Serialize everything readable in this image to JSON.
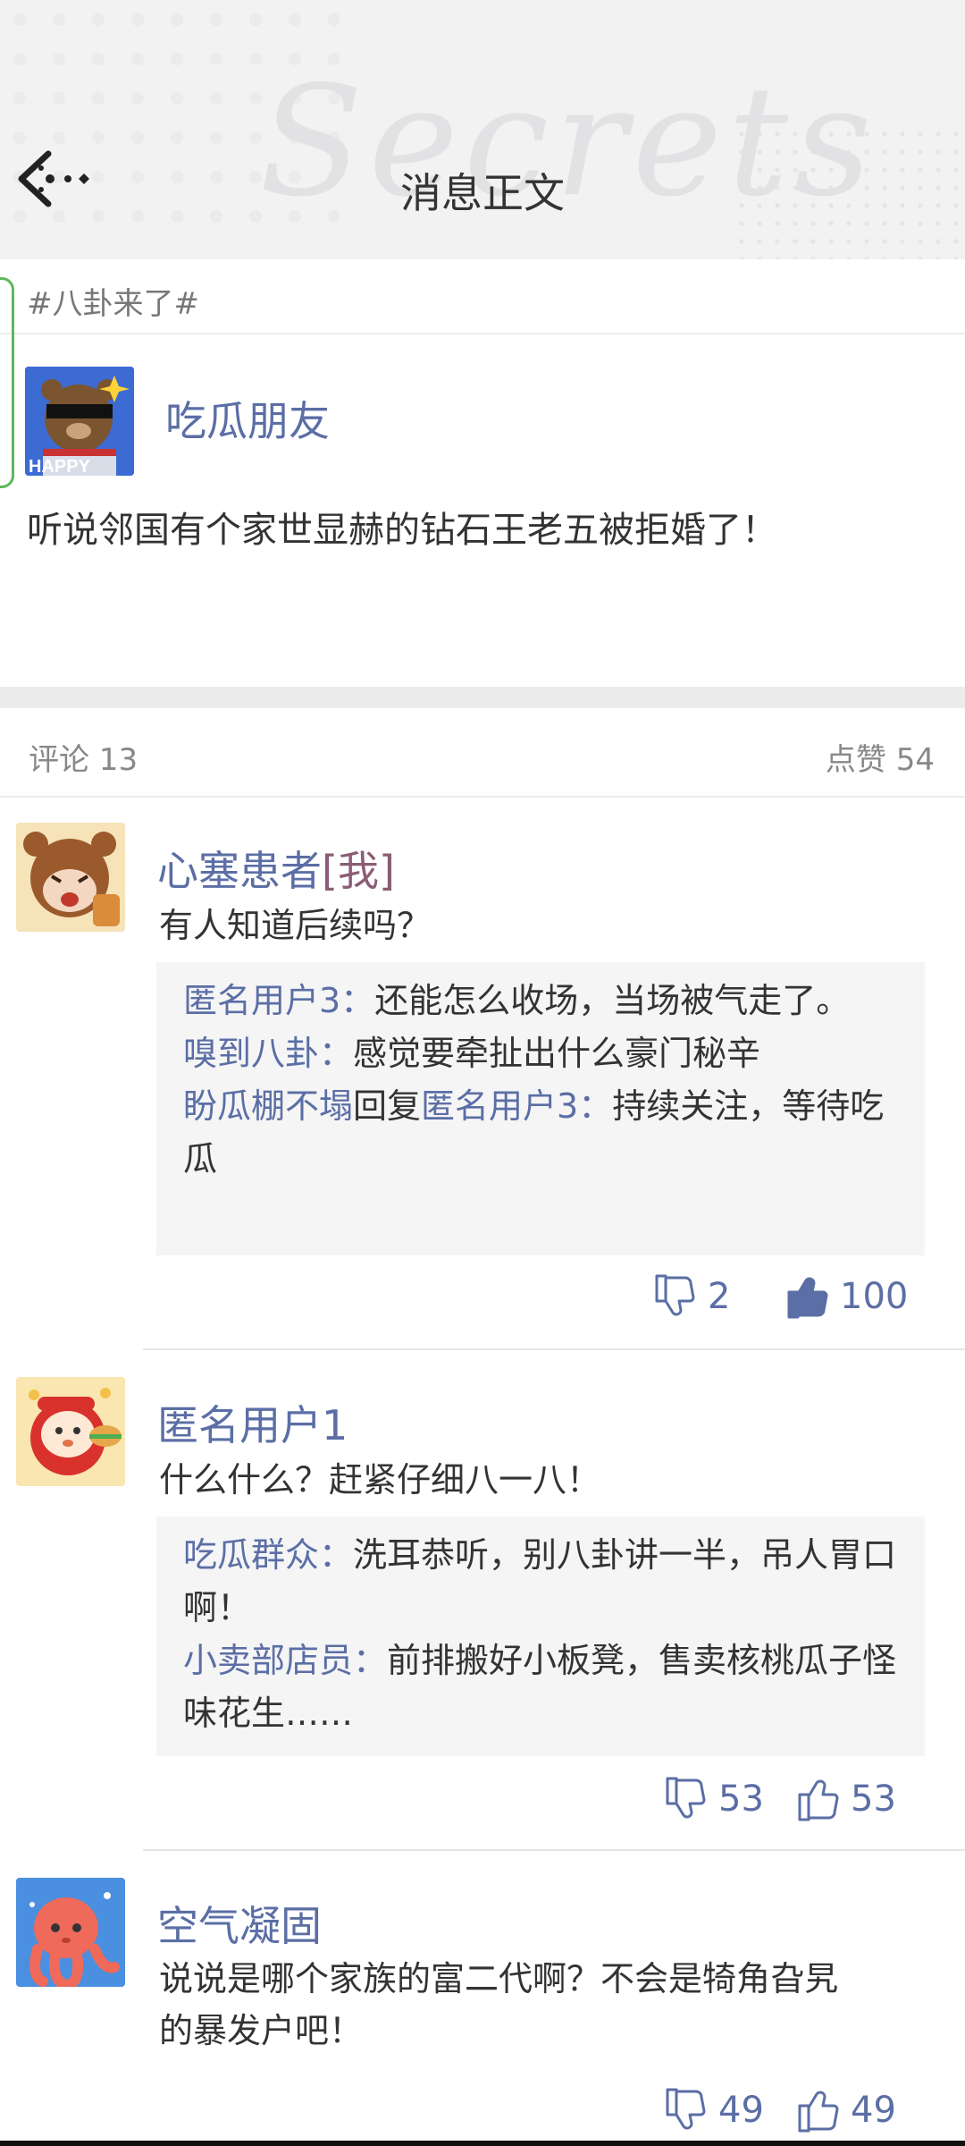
{
  "header": {
    "title": "消息正文",
    "watermark": "Secrets"
  },
  "topic": {
    "label": "#八卦来了#"
  },
  "post": {
    "author": "吃瓜朋友",
    "avatar_caption": "HAPPY",
    "text": "听说邻国有个家世显赫的钻石王老五被拒婚了！"
  },
  "stats": {
    "comments": "评论 13",
    "likes": "点赞 54"
  },
  "comments": [
    {
      "name": "心塞患者",
      "me_tag": "[我]",
      "text": "有人知道后续吗？",
      "replies": [
        {
          "user": "匿名用户3：",
          "text": "还能怎么收场，当场被气走了。"
        },
        {
          "user": "嗅到八卦：",
          "text": "感觉要牵扯出什么豪门秘辛"
        },
        {
          "user": "盼瓜棚不塌",
          "mid": "回复",
          "target": "匿名用户3：",
          "text": "持续关注，等待吃瓜"
        }
      ],
      "dislikes": "2",
      "likes": "100",
      "liked": true
    },
    {
      "name": "匿名用户1",
      "text": "什么什么？赶紧仔细八一八！",
      "replies": [
        {
          "user": "吃瓜群众：",
          "text": "洗耳恭听，别八卦讲一半，吊人胃口啊！"
        },
        {
          "user": "小卖部店员：",
          "text": "前排搬好小板凳，售卖核桃瓜子怪味花生……"
        }
      ],
      "dislikes": "53",
      "likes": "53",
      "liked": false
    },
    {
      "name": "空气凝固",
      "text_line1": "说说是哪个家族的富二代啊？不会是犄角旮旯",
      "text_line2": "的暴发户吧！",
      "dislikes": "49",
      "likes": "49",
      "liked": false
    }
  ],
  "colors": {
    "link": "#5b6ea5",
    "me_tag": "#8a5d74",
    "reply_bg": "#f5f5f6"
  },
  "icons": [
    "back-arrow-icon",
    "thumbs-down-icon",
    "thumbs-up-icon"
  ]
}
